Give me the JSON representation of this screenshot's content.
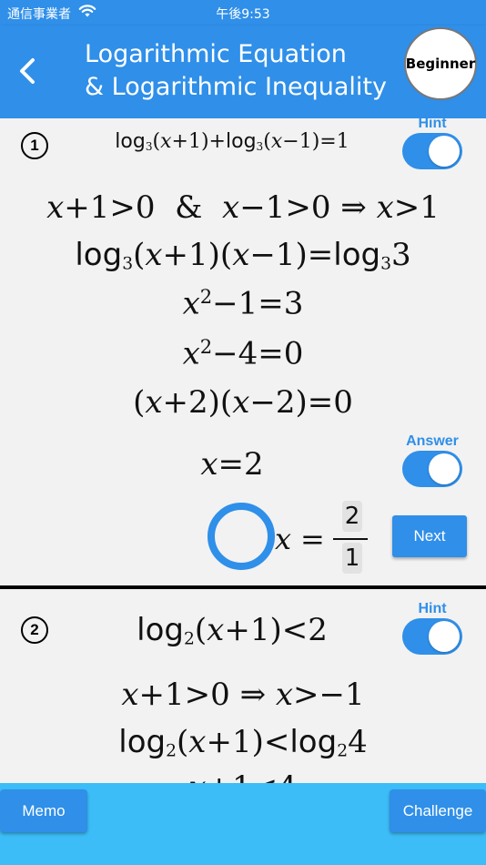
{
  "status_bar": {
    "carrier": "通信事業者",
    "time": "午後9:53"
  },
  "header": {
    "title_line1": "Logarithmic Equation",
    "title_line2": "& Logarithmic Inequality",
    "level": "Beginner"
  },
  "problem1": {
    "number": "1",
    "hint_label": "Hint",
    "hint_on": true,
    "answer_label": "Answer",
    "answer_on": true,
    "result_mark": "correct",
    "user_answer": {
      "variable": "x",
      "numerator": "2",
      "denominator": "1"
    },
    "next_label": "Next"
  },
  "problem2": {
    "number": "2",
    "hint_label": "Hint",
    "hint_on": true
  },
  "footer": {
    "memo_label": "Memo",
    "challenge_label": "Challenge"
  },
  "colors": {
    "primary": "#2f8fe9",
    "footer": "#3cbdf7"
  }
}
